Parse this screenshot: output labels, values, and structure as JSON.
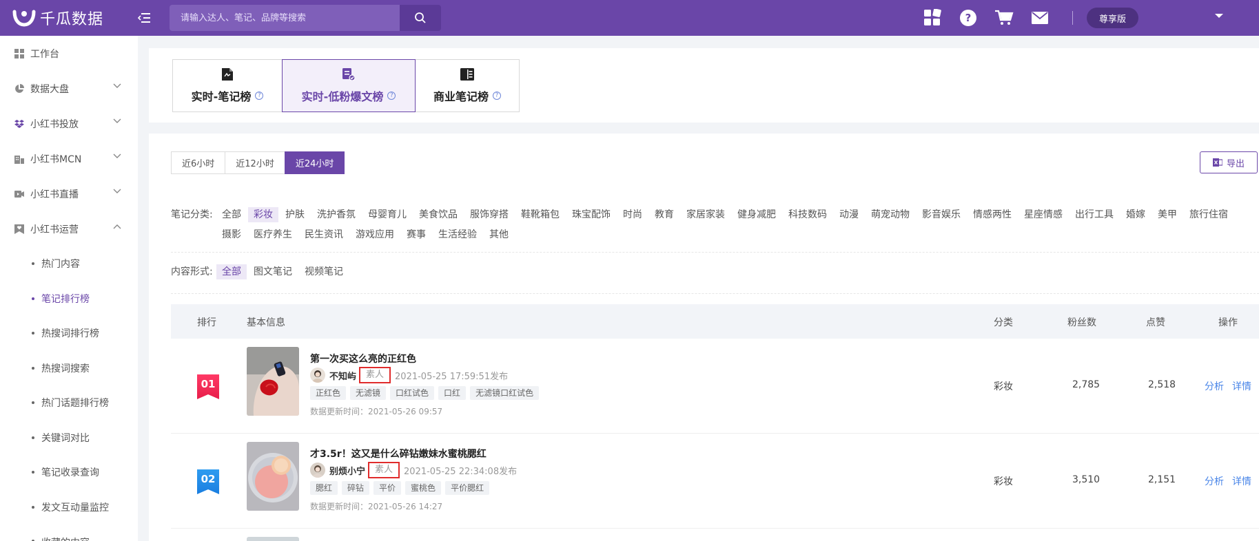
{
  "app": {
    "name": "千瓜数据",
    "search_placeholder": "请输入达人、笔记、品牌等搜索",
    "tier": "尊享版",
    "colors": {
      "brand": "#6a46a8",
      "link": "#4a86e8",
      "highlight": "#e02b2b"
    }
  },
  "sidebar": {
    "items": [
      {
        "label": "工作台",
        "icon": "dashboard-icon"
      },
      {
        "label": "数据大盘",
        "icon": "pie-chart-icon"
      },
      {
        "label": "小红书投放",
        "icon": "dropbox-icon"
      },
      {
        "label": "小红书MCN",
        "icon": "building-icon"
      },
      {
        "label": "小红书直播",
        "icon": "video-camera-icon"
      },
      {
        "label": "小红书运营",
        "icon": "heart-card-icon"
      }
    ],
    "sub_items": [
      "热门内容",
      "笔记排行榜",
      "热搜词排行榜",
      "热搜词搜索",
      "热门话题排行榜",
      "关键词对比",
      "笔记收录查询",
      "发文互动量监控",
      "收藏的内容"
    ]
  },
  "rank_tabs": [
    {
      "label": "实时-笔记榜"
    },
    {
      "label": "实时-低粉爆文榜"
    },
    {
      "label": "商业笔记榜"
    }
  ],
  "time_tabs": [
    "近6小时",
    "近12小时",
    "近24小时"
  ],
  "export_label": "导出",
  "filters": {
    "category_label": "笔记分类:",
    "categories": [
      "全部",
      "彩妆",
      "护肤",
      "洗护香氛",
      "母婴育儿",
      "美食饮品",
      "服饰穿搭",
      "鞋靴箱包",
      "珠宝配饰",
      "时尚",
      "教育",
      "家居家装",
      "健身减肥",
      "科技数码",
      "动漫",
      "萌宠动物",
      "影音娱乐",
      "情感两性",
      "星座情感",
      "出行工具",
      "婚嫁",
      "美甲",
      "旅行住宿",
      "摄影",
      "医疗养生",
      "民生资讯",
      "游戏应用",
      "赛事",
      "生活经验",
      "其他"
    ],
    "format_label": "内容形式:",
    "formats": [
      "全部",
      "图文笔记",
      "视频笔记"
    ]
  },
  "table": {
    "headers": {
      "rank": "排行",
      "info": "基本信息",
      "category": "分类",
      "fans": "粉丝数",
      "likes": "点赞",
      "actions": "操作"
    },
    "rows": [
      {
        "rank": "01",
        "title": "第一次买这么亮的正红色",
        "author": "不知屿",
        "author_type": "素人",
        "publish": "2021-05-25 17:59:51发布",
        "tags": [
          "正红色",
          "无滤镜",
          "口红试色",
          "口红",
          "无滤镜口红试色"
        ],
        "update": "数据更新时间：2021-05-26 09:57",
        "category": "彩妆",
        "fans": "2,785",
        "likes": "2,518",
        "analyze": "分析",
        "detail": "详情"
      },
      {
        "rank": "02",
        "title": "才3.5r！这又是什么碎钻嫩妹水蜜桃腮红",
        "author": "别烦小宁",
        "author_type": "素人",
        "publish": "2021-05-25 22:34:08发布",
        "tags": [
          "腮红",
          "碎钻",
          "平价",
          "蜜桃色",
          "平价腮红"
        ],
        "update": "数据更新时间：2021-05-26 14:27",
        "category": "彩妆",
        "fans": "3,510",
        "likes": "2,151",
        "analyze": "分析",
        "detail": "详情"
      }
    ]
  }
}
